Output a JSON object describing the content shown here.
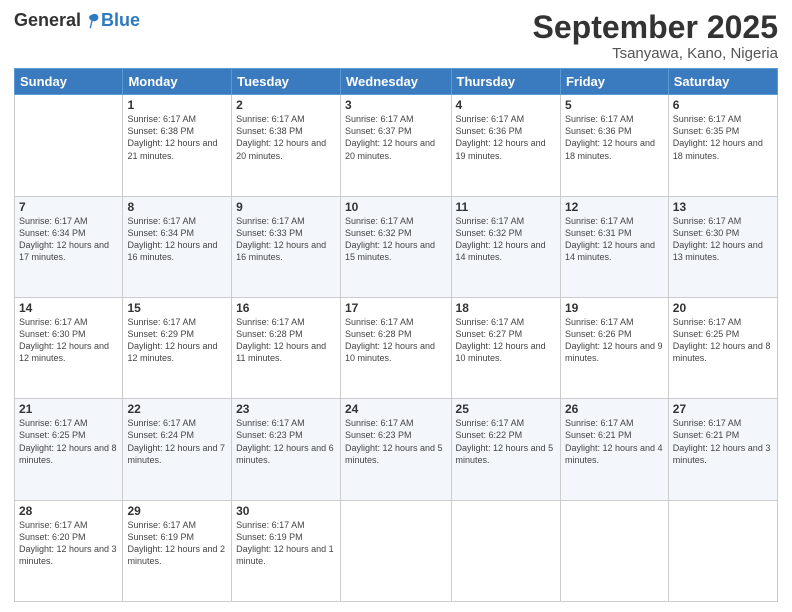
{
  "header": {
    "logo_general": "General",
    "logo_blue": "Blue",
    "month_title": "September 2025",
    "location": "Tsanyawa, Kano, Nigeria"
  },
  "days_of_week": [
    "Sunday",
    "Monday",
    "Tuesday",
    "Wednesday",
    "Thursday",
    "Friday",
    "Saturday"
  ],
  "weeks": [
    [
      {
        "num": "",
        "sunrise": "",
        "sunset": "",
        "daylight": "",
        "empty": true
      },
      {
        "num": "1",
        "sunrise": "Sunrise: 6:17 AM",
        "sunset": "Sunset: 6:38 PM",
        "daylight": "Daylight: 12 hours and 21 minutes."
      },
      {
        "num": "2",
        "sunrise": "Sunrise: 6:17 AM",
        "sunset": "Sunset: 6:38 PM",
        "daylight": "Daylight: 12 hours and 20 minutes."
      },
      {
        "num": "3",
        "sunrise": "Sunrise: 6:17 AM",
        "sunset": "Sunset: 6:37 PM",
        "daylight": "Daylight: 12 hours and 20 minutes."
      },
      {
        "num": "4",
        "sunrise": "Sunrise: 6:17 AM",
        "sunset": "Sunset: 6:36 PM",
        "daylight": "Daylight: 12 hours and 19 minutes."
      },
      {
        "num": "5",
        "sunrise": "Sunrise: 6:17 AM",
        "sunset": "Sunset: 6:36 PM",
        "daylight": "Daylight: 12 hours and 18 minutes."
      },
      {
        "num": "6",
        "sunrise": "Sunrise: 6:17 AM",
        "sunset": "Sunset: 6:35 PM",
        "daylight": "Daylight: 12 hours and 18 minutes."
      }
    ],
    [
      {
        "num": "7",
        "sunrise": "Sunrise: 6:17 AM",
        "sunset": "Sunset: 6:34 PM",
        "daylight": "Daylight: 12 hours and 17 minutes."
      },
      {
        "num": "8",
        "sunrise": "Sunrise: 6:17 AM",
        "sunset": "Sunset: 6:34 PM",
        "daylight": "Daylight: 12 hours and 16 minutes."
      },
      {
        "num": "9",
        "sunrise": "Sunrise: 6:17 AM",
        "sunset": "Sunset: 6:33 PM",
        "daylight": "Daylight: 12 hours and 16 minutes."
      },
      {
        "num": "10",
        "sunrise": "Sunrise: 6:17 AM",
        "sunset": "Sunset: 6:32 PM",
        "daylight": "Daylight: 12 hours and 15 minutes."
      },
      {
        "num": "11",
        "sunrise": "Sunrise: 6:17 AM",
        "sunset": "Sunset: 6:32 PM",
        "daylight": "Daylight: 12 hours and 14 minutes."
      },
      {
        "num": "12",
        "sunrise": "Sunrise: 6:17 AM",
        "sunset": "Sunset: 6:31 PM",
        "daylight": "Daylight: 12 hours and 14 minutes."
      },
      {
        "num": "13",
        "sunrise": "Sunrise: 6:17 AM",
        "sunset": "Sunset: 6:30 PM",
        "daylight": "Daylight: 12 hours and 13 minutes."
      }
    ],
    [
      {
        "num": "14",
        "sunrise": "Sunrise: 6:17 AM",
        "sunset": "Sunset: 6:30 PM",
        "daylight": "Daylight: 12 hours and 12 minutes."
      },
      {
        "num": "15",
        "sunrise": "Sunrise: 6:17 AM",
        "sunset": "Sunset: 6:29 PM",
        "daylight": "Daylight: 12 hours and 12 minutes."
      },
      {
        "num": "16",
        "sunrise": "Sunrise: 6:17 AM",
        "sunset": "Sunset: 6:28 PM",
        "daylight": "Daylight: 12 hours and 11 minutes."
      },
      {
        "num": "17",
        "sunrise": "Sunrise: 6:17 AM",
        "sunset": "Sunset: 6:28 PM",
        "daylight": "Daylight: 12 hours and 10 minutes."
      },
      {
        "num": "18",
        "sunrise": "Sunrise: 6:17 AM",
        "sunset": "Sunset: 6:27 PM",
        "daylight": "Daylight: 12 hours and 10 minutes."
      },
      {
        "num": "19",
        "sunrise": "Sunrise: 6:17 AM",
        "sunset": "Sunset: 6:26 PM",
        "daylight": "Daylight: 12 hours and 9 minutes."
      },
      {
        "num": "20",
        "sunrise": "Sunrise: 6:17 AM",
        "sunset": "Sunset: 6:25 PM",
        "daylight": "Daylight: 12 hours and 8 minutes."
      }
    ],
    [
      {
        "num": "21",
        "sunrise": "Sunrise: 6:17 AM",
        "sunset": "Sunset: 6:25 PM",
        "daylight": "Daylight: 12 hours and 8 minutes."
      },
      {
        "num": "22",
        "sunrise": "Sunrise: 6:17 AM",
        "sunset": "Sunset: 6:24 PM",
        "daylight": "Daylight: 12 hours and 7 minutes."
      },
      {
        "num": "23",
        "sunrise": "Sunrise: 6:17 AM",
        "sunset": "Sunset: 6:23 PM",
        "daylight": "Daylight: 12 hours and 6 minutes."
      },
      {
        "num": "24",
        "sunrise": "Sunrise: 6:17 AM",
        "sunset": "Sunset: 6:23 PM",
        "daylight": "Daylight: 12 hours and 5 minutes."
      },
      {
        "num": "25",
        "sunrise": "Sunrise: 6:17 AM",
        "sunset": "Sunset: 6:22 PM",
        "daylight": "Daylight: 12 hours and 5 minutes."
      },
      {
        "num": "26",
        "sunrise": "Sunrise: 6:17 AM",
        "sunset": "Sunset: 6:21 PM",
        "daylight": "Daylight: 12 hours and 4 minutes."
      },
      {
        "num": "27",
        "sunrise": "Sunrise: 6:17 AM",
        "sunset": "Sunset: 6:21 PM",
        "daylight": "Daylight: 12 hours and 3 minutes."
      }
    ],
    [
      {
        "num": "28",
        "sunrise": "Sunrise: 6:17 AM",
        "sunset": "Sunset: 6:20 PM",
        "daylight": "Daylight: 12 hours and 3 minutes."
      },
      {
        "num": "29",
        "sunrise": "Sunrise: 6:17 AM",
        "sunset": "Sunset: 6:19 PM",
        "daylight": "Daylight: 12 hours and 2 minutes."
      },
      {
        "num": "30",
        "sunrise": "Sunrise: 6:17 AM",
        "sunset": "Sunset: 6:19 PM",
        "daylight": "Daylight: 12 hours and 1 minute."
      },
      {
        "num": "",
        "sunrise": "",
        "sunset": "",
        "daylight": "",
        "empty": true
      },
      {
        "num": "",
        "sunrise": "",
        "sunset": "",
        "daylight": "",
        "empty": true
      },
      {
        "num": "",
        "sunrise": "",
        "sunset": "",
        "daylight": "",
        "empty": true
      },
      {
        "num": "",
        "sunrise": "",
        "sunset": "",
        "daylight": "",
        "empty": true
      }
    ]
  ]
}
